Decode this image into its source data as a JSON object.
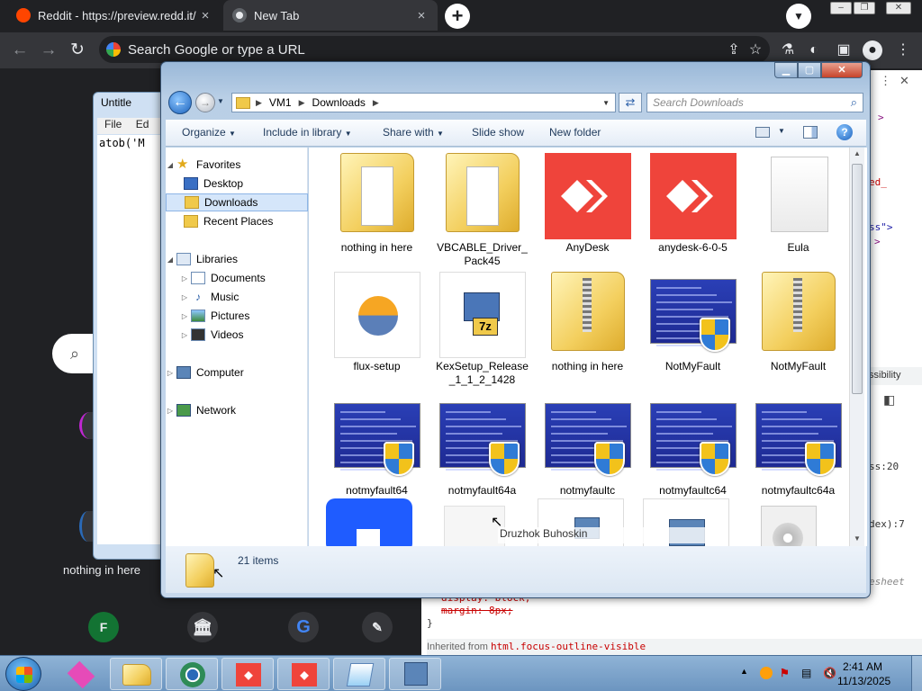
{
  "browser": {
    "tabs": [
      {
        "title": "Reddit - https://preview.redd.it/",
        "close": "×"
      },
      {
        "title": "New Tab",
        "close": "×"
      }
    ],
    "new_tab": "+",
    "omnibox_placeholder": "Search Google or type a URL",
    "ntp": {
      "shortcut_label": "nothing in here",
      "shortcut_initial": "F"
    }
  },
  "notepad": {
    "title": "Untitle",
    "menu": [
      "File",
      "Ed"
    ],
    "text": "atob('M"
  },
  "devtools": {
    "fragments": [
      ">",
      "ed_",
      "ss\">",
      ">",
      "ssibility",
      "ss:20",
      "dex):7",
      "esheet"
    ],
    "bottom_lines": [
      "display: block;",
      "margin: 8px;",
      "}"
    ],
    "inherited_label": "Inherited from",
    "inherited_selector": "html.focus-outline-visible"
  },
  "explorer": {
    "breadcrumb": [
      "VM1",
      "Downloads"
    ],
    "search_placeholder": "Search Downloads",
    "commands": [
      "Organize",
      "Include in library",
      "Share with",
      "Slide show",
      "New folder"
    ],
    "nav": {
      "favorites": {
        "label": "Favorites",
        "items": [
          "Desktop",
          "Downloads",
          "Recent Places"
        ]
      },
      "libraries": {
        "label": "Libraries",
        "items": [
          "Documents",
          "Music",
          "Pictures",
          "Videos"
        ]
      },
      "computer": "Computer",
      "network": "Network"
    },
    "items": [
      {
        "label": "nothing in here",
        "type": "folder-docs"
      },
      {
        "label": "VBCABLE_Driver_\nPack45",
        "type": "folder-docs"
      },
      {
        "label": "AnyDesk",
        "type": "anydesk"
      },
      {
        "label": "anydesk-6-0-5",
        "type": "anydesk"
      },
      {
        "label": "Eula",
        "type": "doc"
      },
      {
        "label": "flux-setup",
        "type": "flux"
      },
      {
        "label": "KexSetup_Release\n_1_1_2_1428",
        "type": "7z"
      },
      {
        "label": "nothing in here",
        "type": "zip"
      },
      {
        "label": "NotMyFault",
        "type": "bsod"
      },
      {
        "label": "NotMyFault",
        "type": "zip"
      },
      {
        "label": "notmyfault64",
        "type": "bsod"
      },
      {
        "label": "notmyfault64a",
        "type": "bsod"
      },
      {
        "label": "notmyfaultc",
        "type": "bsod"
      },
      {
        "label": "notmyfaultc64",
        "type": "bsod"
      },
      {
        "label": "notmyfaultc64a",
        "type": "bsod"
      }
    ],
    "tooltip": "Druzhok Buhoskin",
    "status": "21 items"
  },
  "taskbar": {
    "time": "2:41 AM",
    "date": "11/13/2025"
  },
  "colors": {
    "chrome_dark": "#202124",
    "anydesk_red": "#ef443b",
    "explorer_frame": "#b9cfe6",
    "taskbar": "#7aa2cb"
  }
}
